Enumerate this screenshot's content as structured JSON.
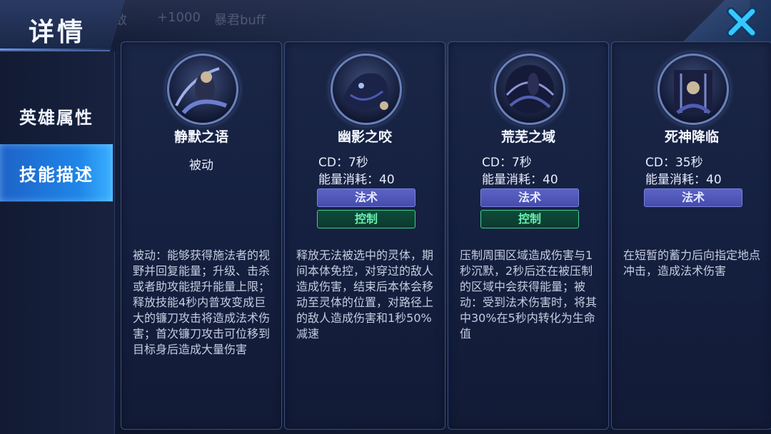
{
  "header": {
    "title": "详情",
    "bg_texts": [
      "敌",
      "+1000",
      "暴君buff"
    ]
  },
  "sidebar": {
    "items": [
      {
        "label": "英雄属性",
        "active": false
      },
      {
        "label": "技能描述",
        "active": true
      }
    ]
  },
  "skills": [
    {
      "name": "静默之语",
      "passive_label": "被动",
      "icon": "reaper-hero-icon",
      "description": "被动：能够获得施法者的视野并回复能量；升级、击杀或者助攻能提升能量上限；释放技能4秒内普攻变成巨大的镰刀攻击将造成法术伤害；首次镰刀攻击可位移到目标身后造成大量伤害"
    },
    {
      "name": "幽影之咬",
      "cd": "CD：7秒",
      "cost": "能量消耗：40",
      "tags": [
        "法术",
        "控制"
      ],
      "icon": "shadow-beast-icon",
      "description": "释放无法被选中的灵体，期间本体免控，对穿过的敌人造成伤害，结束后本体会移动至灵体的位置，对路径上的敌人造成伤害和1秒50%减速"
    },
    {
      "name": "荒芜之域",
      "cd": "CD：7秒",
      "cost": "能量消耗：40",
      "tags": [
        "法术",
        "控制"
      ],
      "icon": "dark-domain-icon",
      "description": "压制周围区域造成伤害与1秒沉默，2秒后还在被压制的区域中会获得能量；被动：受到法术伤害时，将其中30%在5秒内转化为生命值"
    },
    {
      "name": "死神降临",
      "cd": "CD：35秒",
      "cost": "能量消耗：40",
      "tags": [
        "法术"
      ],
      "icon": "death-descends-icon",
      "description": "在短暂的蓄力后向指定地点冲击，造成法术伤害"
    }
  ],
  "colors": {
    "accent": "#1f86e8",
    "magic_tag": "#5b63c8",
    "control_tag": "#3fcf8e",
    "close_icon": "#35c8ff"
  }
}
